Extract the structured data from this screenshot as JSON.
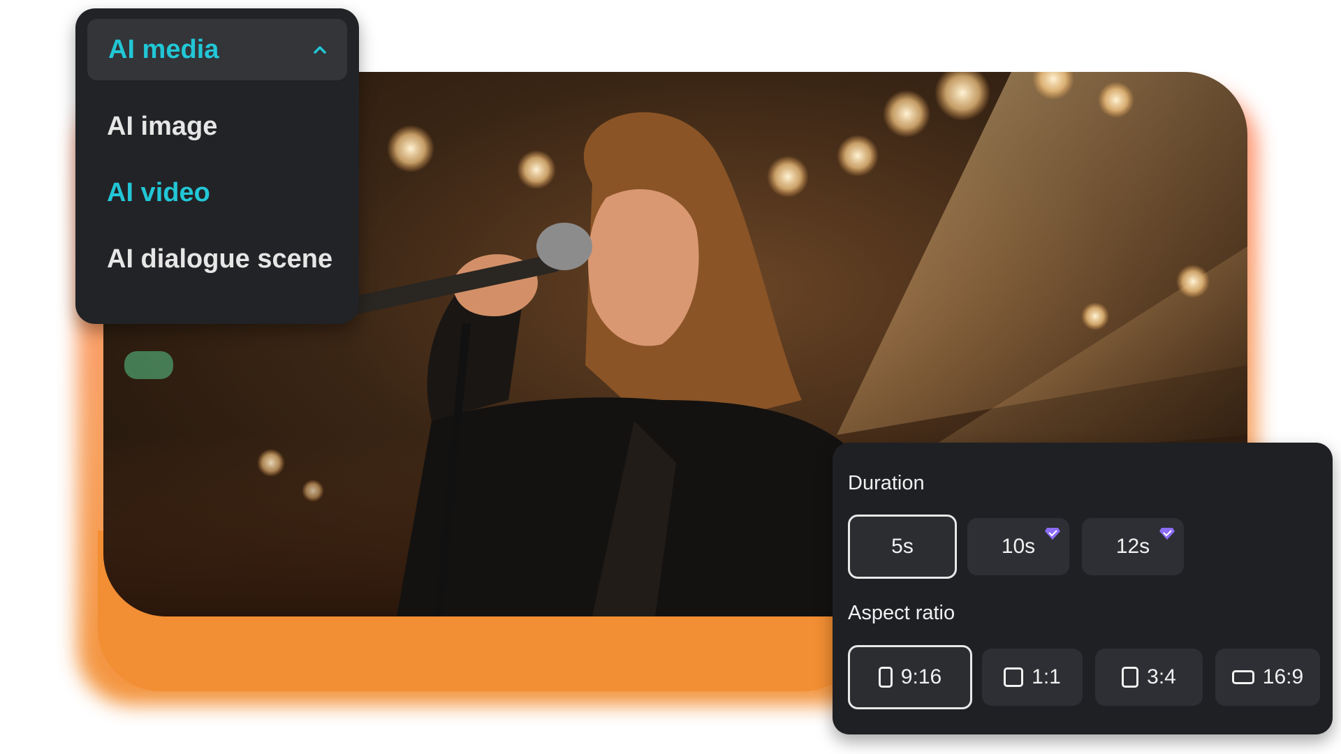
{
  "menu": {
    "title": "AI media",
    "items": [
      {
        "label": "AI image",
        "active": false
      },
      {
        "label": "AI video",
        "active": true
      },
      {
        "label": "AI dialogue scene",
        "active": false
      }
    ],
    "accent": "#22c7d6"
  },
  "settings": {
    "duration_label": "Duration",
    "durations": [
      {
        "label": "5s",
        "selected": true,
        "premium": false
      },
      {
        "label": "10s",
        "selected": false,
        "premium": true
      },
      {
        "label": "12s",
        "selected": false,
        "premium": true
      }
    ],
    "aspect_label": "Aspect ratio",
    "ratios": [
      {
        "label": "9:16",
        "selected": true,
        "icon": "portrait-frame-icon"
      },
      {
        "label": "1:1",
        "selected": false,
        "icon": "square-frame-icon"
      },
      {
        "label": "3:4",
        "selected": false,
        "icon": "portrait-frame-icon"
      },
      {
        "label": "16:9",
        "selected": false,
        "icon": "landscape-frame-icon"
      }
    ]
  },
  "colors": {
    "panel_bg": "#1f2024",
    "glow_orange": "#f28e33",
    "premium_gem": "#8b6cf6"
  },
  "image": {
    "subject": "singer-with-microphone"
  }
}
